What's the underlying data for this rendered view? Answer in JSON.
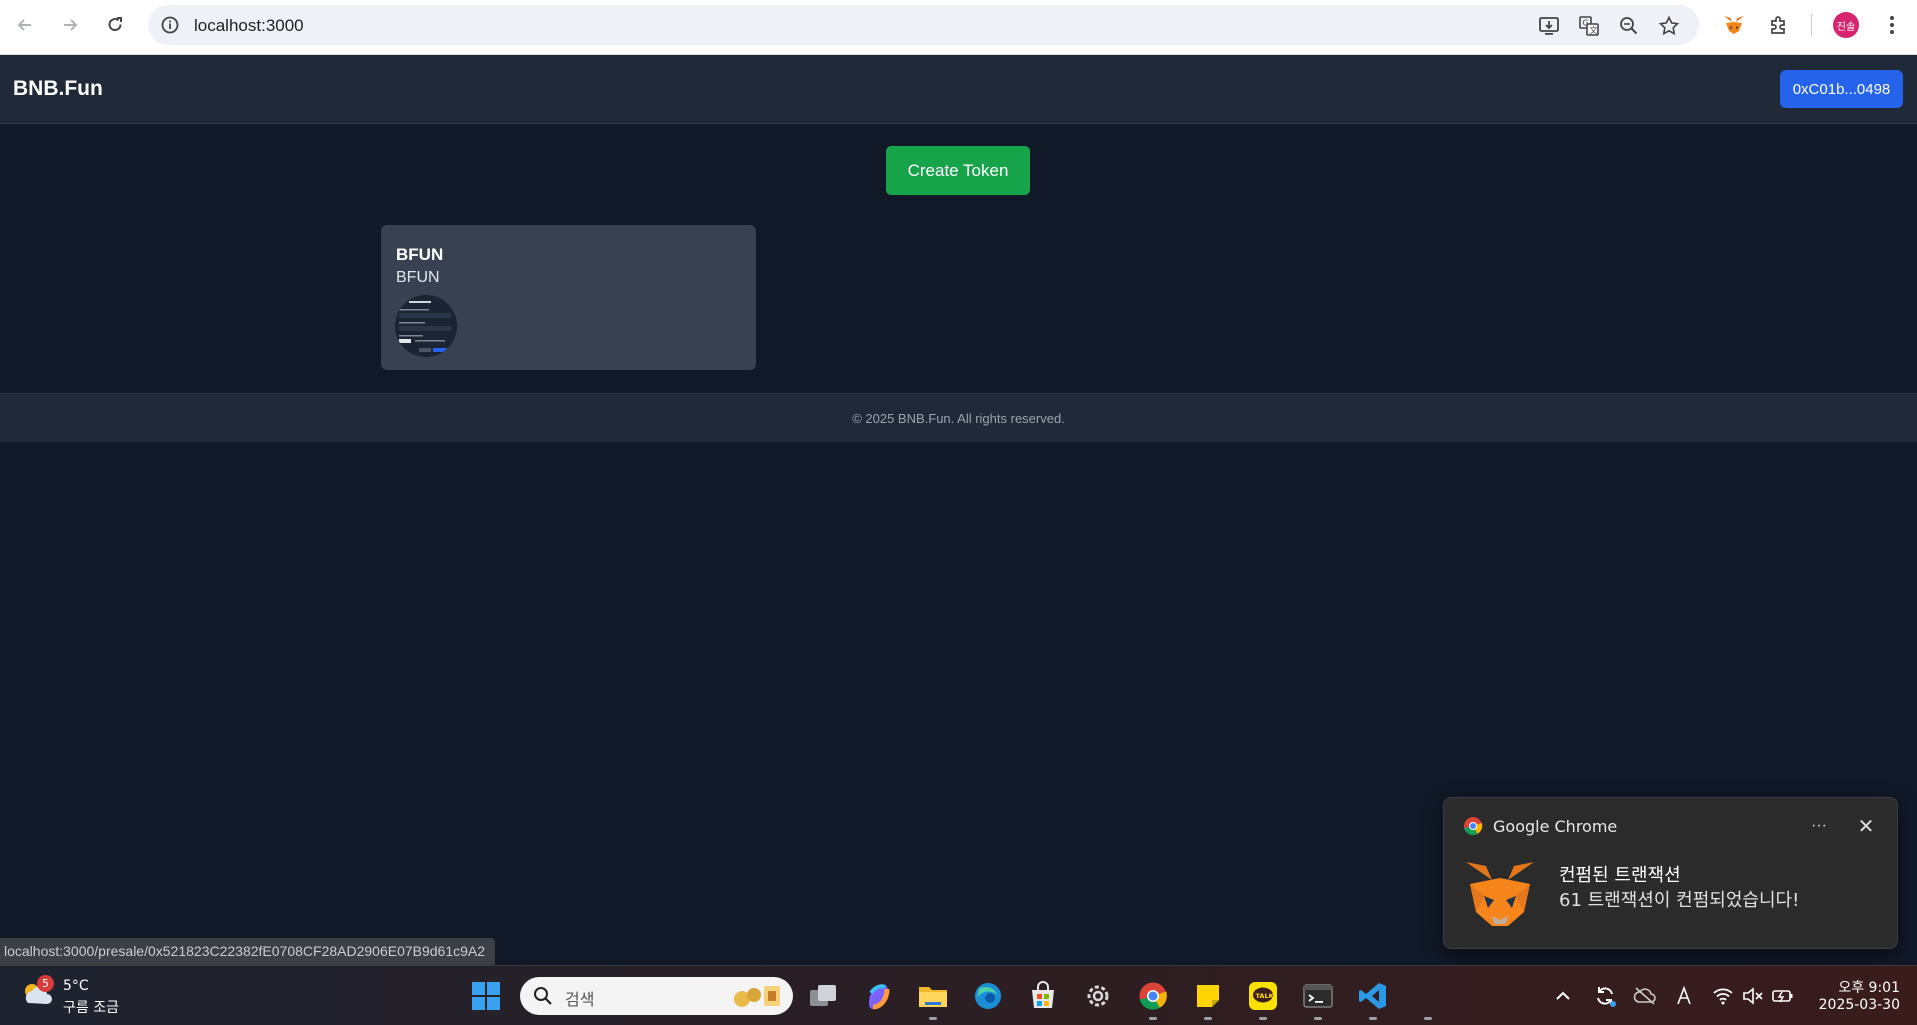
{
  "browser": {
    "url": "localhost:3000",
    "profile_initial": "진솔",
    "status_url": "localhost:3000/presale/0x521823C22382fE0708CF28AD2906E07B9d61c9A2"
  },
  "app": {
    "brand": "BNB.Fun",
    "wallet_label": "0xC01b...0498",
    "create_label": "Create Token",
    "tokens": [
      {
        "name": "BFUN",
        "symbol": "BFUN"
      }
    ],
    "footer": "© 2025 BNB.Fun. All rights reserved."
  },
  "notification": {
    "app_name": "Google Chrome",
    "title": "컨펌된 트랜잭션",
    "body": "61 트랜잭션이 컨펌되었습니다!"
  },
  "taskbar": {
    "weather_badge": "5",
    "weather_temp": "5°C",
    "weather_desc": "구름 조금",
    "search_placeholder": "검색",
    "time": "오후 9:01",
    "date": "2025-03-30"
  },
  "colors": {
    "page_bg": "#111827",
    "header_bg": "#1f2937",
    "card_bg": "#374151",
    "create_green": "#16a34a",
    "wallet_blue": "#2563eb"
  }
}
